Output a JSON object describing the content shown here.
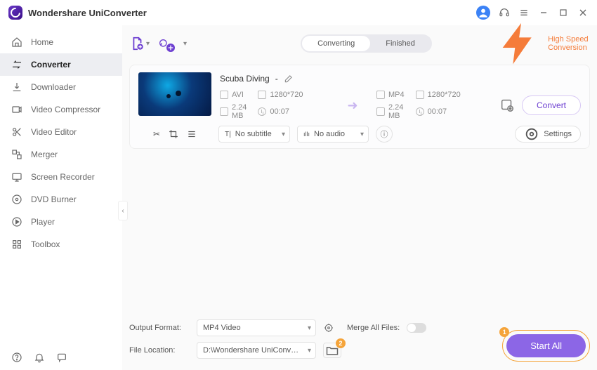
{
  "app": {
    "title": "Wondershare UniConverter"
  },
  "sidebar": {
    "items": [
      {
        "label": "Home",
        "key": "home"
      },
      {
        "label": "Converter",
        "key": "converter"
      },
      {
        "label": "Downloader",
        "key": "downloader"
      },
      {
        "label": "Video Compressor",
        "key": "compressor"
      },
      {
        "label": "Video Editor",
        "key": "editor"
      },
      {
        "label": "Merger",
        "key": "merger"
      },
      {
        "label": "Screen Recorder",
        "key": "recorder"
      },
      {
        "label": "DVD Burner",
        "key": "dvd"
      },
      {
        "label": "Player",
        "key": "player"
      },
      {
        "label": "Toolbox",
        "key": "toolbox"
      }
    ],
    "active_index": 1
  },
  "topshelf": {
    "tabs": [
      "Converting",
      "Finished"
    ],
    "active_tab": 0,
    "high_speed_label": "High Speed Conversion"
  },
  "task": {
    "title": "Scuba Diving",
    "title_suffix": " - ",
    "source": {
      "format": "AVI",
      "resolution": "1280*720",
      "size": "2.24 MB",
      "duration": "00:07"
    },
    "target": {
      "format": "MP4",
      "resolution": "1280*720",
      "size": "2.24 MB",
      "duration": "00:07"
    },
    "subtitle_select": "No subtitle",
    "audio_select": "No audio",
    "settings_label": "Settings",
    "convert_label": "Convert"
  },
  "footer": {
    "output_format_label": "Output Format:",
    "output_format_value": "MP4 Video",
    "file_location_label": "File Location:",
    "file_location_value": "D:\\Wondershare UniConverter",
    "merge_label": "Merge All Files:",
    "merge_on": false,
    "start_all_label": "Start All",
    "badge1": "1",
    "badge2": "2"
  }
}
